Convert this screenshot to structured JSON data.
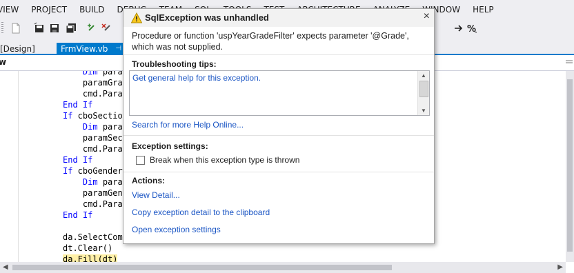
{
  "menu": [
    "VIEW",
    "PROJECT",
    "BUILD",
    "DEBUG",
    "TEAM",
    "SQL",
    "TOOLS",
    "TEST",
    "ARCHITECTURE",
    "ANALYZE",
    "WINDOW",
    "HELP"
  ],
  "tabs": {
    "design": "[Design]",
    "active": "FrmView.vb",
    "pin": "⊣"
  },
  "nav": {
    "label": "w"
  },
  "code_lines": [
    {
      "text": "    Dim param",
      "kw": "Dim"
    },
    {
      "text": "    paramGrad"
    },
    {
      "text": "    cmd.Param"
    },
    {
      "text": "End If",
      "kw": "End If"
    },
    {
      "text": "If cboSection",
      "kw": "If"
    },
    {
      "text": "    Dim param",
      "kw": "Dim"
    },
    {
      "text": "    paramSect"
    },
    {
      "text": "    cmd.Param"
    },
    {
      "text": "End If",
      "kw": "End If"
    },
    {
      "text": "If cboGender",
      "kw": "If"
    },
    {
      "text": "    Dim param",
      "kw": "Dim"
    },
    {
      "text": "    paramGend"
    },
    {
      "text": "    cmd.Param"
    },
    {
      "text": "End If",
      "kw": "End If"
    },
    {
      "text": ""
    },
    {
      "text": "da.SelectComm"
    },
    {
      "text": "dt.Clear()"
    },
    {
      "text": "da.Fill(dt)"
    }
  ],
  "popup": {
    "title": "SqlException was unhandled",
    "close": "×",
    "message": "Procedure or function 'uspYearGradeFilter' expects parameter '@Grade', which was not supplied.",
    "tips_title": "Troubleshooting tips:",
    "tip_link": "Get general help for this exception.",
    "search_link": "Search for more Help Online...",
    "settings_title": "Exception settings:",
    "break_label": "Break when this exception type is thrown",
    "break_checked": false,
    "actions_title": "Actions:",
    "actions": [
      "View Detail...",
      "Copy exception detail to the clipboard",
      "Open exception settings"
    ]
  },
  "colors": {
    "accent": "#007acc",
    "link": "#1a55c4",
    "keyword": "#0000ff",
    "highlight": "#fff0a8"
  },
  "icons": [
    "new-file-icon",
    "save-icon",
    "save-all-icon",
    "undo-icon",
    "redo-icon",
    "step-over-icon",
    "diagnostics-icon"
  ]
}
